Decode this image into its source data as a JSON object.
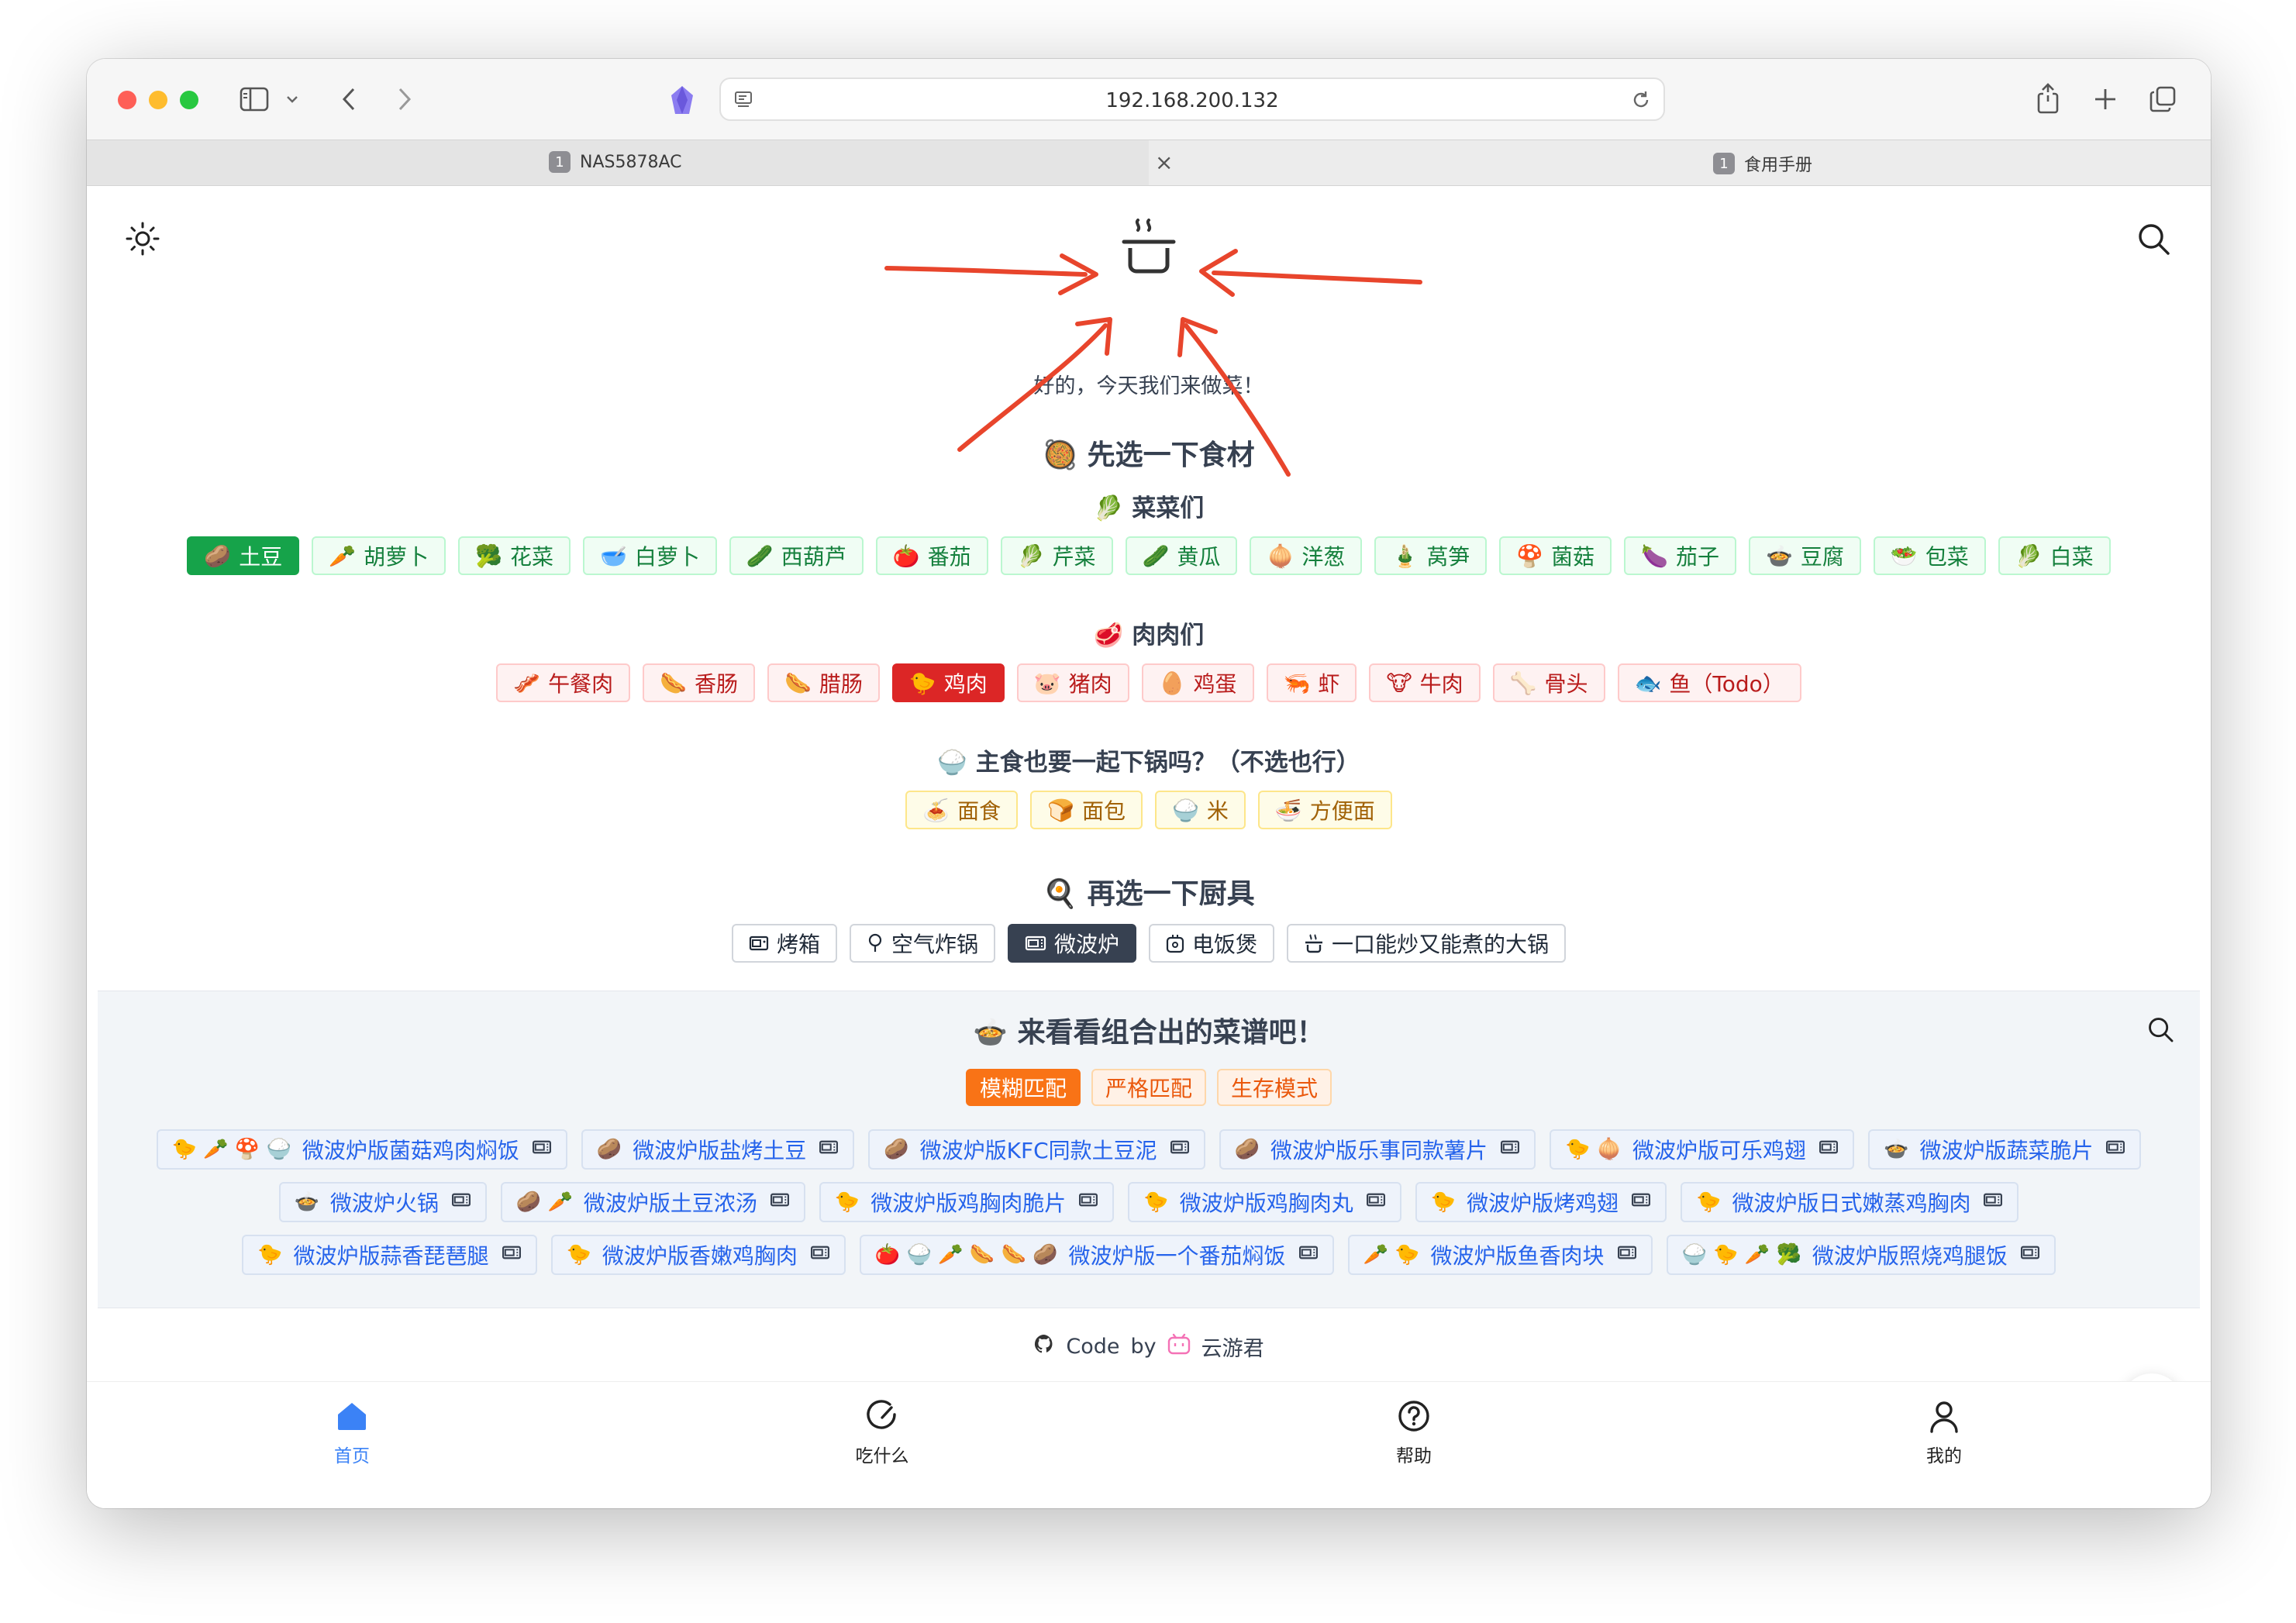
{
  "browser": {
    "url": "192.168.200.132",
    "tabs": [
      {
        "number": "1",
        "label": "NAS5878AC"
      },
      {
        "number": "1",
        "label": "食用手册"
      }
    ]
  },
  "header": {
    "subtitle": "好的，今天我们来做菜！"
  },
  "step1": {
    "title": "先选一下食材",
    "title_emoji": "🥘"
  },
  "vegetables": {
    "title": "菜菜们",
    "title_emoji": "🥬",
    "items": [
      {
        "emoji": "🥔",
        "label": "土豆",
        "selected": true
      },
      {
        "emoji": "🥕",
        "label": "胡萝卜",
        "selected": false
      },
      {
        "emoji": "🥦",
        "label": "花菜",
        "selected": false
      },
      {
        "emoji": "🥣",
        "label": "白萝卜",
        "selected": false
      },
      {
        "emoji": "🥒",
        "label": "西葫芦",
        "selected": false
      },
      {
        "emoji": "🍅",
        "label": "番茄",
        "selected": false
      },
      {
        "emoji": "🥬",
        "label": "芹菜",
        "selected": false
      },
      {
        "emoji": "🥒",
        "label": "黄瓜",
        "selected": false
      },
      {
        "emoji": "🧅",
        "label": "洋葱",
        "selected": false
      },
      {
        "emoji": "🎍",
        "label": "莴笋",
        "selected": false
      },
      {
        "emoji": "🍄",
        "label": "菌菇",
        "selected": false
      },
      {
        "emoji": "🍆",
        "label": "茄子",
        "selected": false
      },
      {
        "emoji": "🍲",
        "label": "豆腐",
        "selected": false
      },
      {
        "emoji": "🥗",
        "label": "包菜",
        "selected": false
      },
      {
        "emoji": "🥬",
        "label": "白菜",
        "selected": false
      }
    ]
  },
  "meats": {
    "title": "肉肉们",
    "title_emoji": "🥩",
    "items": [
      {
        "emoji": "🥓",
        "label": "午餐肉",
        "selected": false
      },
      {
        "emoji": "🌭",
        "label": "香肠",
        "selected": false
      },
      {
        "emoji": "🌭",
        "label": "腊肠",
        "selected": false
      },
      {
        "emoji": "🐤",
        "label": "鸡肉",
        "selected": true
      },
      {
        "emoji": "🐷",
        "label": "猪肉",
        "selected": false
      },
      {
        "emoji": "🥚",
        "label": "鸡蛋",
        "selected": false
      },
      {
        "emoji": "🦐",
        "label": "虾",
        "selected": false
      },
      {
        "emoji": "🐮",
        "label": "牛肉",
        "selected": false
      },
      {
        "emoji": "🦴",
        "label": "骨头",
        "selected": false
      },
      {
        "emoji": "🐟",
        "label": "鱼（Todo）",
        "selected": false
      }
    ]
  },
  "staples": {
    "title": "主食也要一起下锅吗？（不选也行）",
    "title_emoji": "🍚",
    "items": [
      {
        "emoji": "🍝",
        "label": "面食"
      },
      {
        "emoji": "🍞",
        "label": "面包"
      },
      {
        "emoji": "🍚",
        "label": "米"
      },
      {
        "emoji": "🍜",
        "label": "方便面"
      }
    ]
  },
  "step2": {
    "title": "再选一下厨具",
    "title_emoji": "🍳"
  },
  "tools": [
    {
      "icon": "oven-icon",
      "label": "烤箱",
      "selected": false
    },
    {
      "icon": "air-fryer-icon",
      "label": "空气炸锅",
      "selected": false
    },
    {
      "icon": "microwave-icon",
      "label": "微波炉",
      "selected": true
    },
    {
      "icon": "rice-cooker-icon",
      "label": "电饭煲",
      "selected": false
    },
    {
      "icon": "pot-icon",
      "label": "一口能炒又能煮的大锅",
      "selected": false
    }
  ],
  "recipes": {
    "title": "来看看组合出的菜谱吧！",
    "title_emoji": "🍲",
    "modes": [
      {
        "label": "模糊匹配",
        "selected": true
      },
      {
        "label": "严格匹配",
        "selected": false
      },
      {
        "label": "生存模式",
        "selected": false
      }
    ],
    "rows": [
      [
        {
          "emojis": "🐤 🥕 🍄 🍚",
          "name": "微波炉版菌菇鸡肉焖饭"
        },
        {
          "emojis": "🥔",
          "name": "微波炉版盐烤土豆"
        },
        {
          "emojis": "🥔",
          "name": "微波炉版KFC同款土豆泥"
        },
        {
          "emojis": "🥔",
          "name": "微波炉版乐事同款薯片"
        },
        {
          "emojis": "🐤 🧅",
          "name": "微波炉版可乐鸡翅"
        },
        {
          "emojis": "🍲",
          "name": "微波炉版蔬菜脆片"
        }
      ],
      [
        {
          "emojis": "🍲",
          "name": "微波炉火锅"
        },
        {
          "emojis": "🥔 🥕",
          "name": "微波炉版土豆浓汤"
        },
        {
          "emojis": "🐤",
          "name": "微波炉版鸡胸肉脆片"
        },
        {
          "emojis": "🐤",
          "name": "微波炉版鸡胸肉丸"
        },
        {
          "emojis": "🐤",
          "name": "微波炉版烤鸡翅"
        },
        {
          "emojis": "🐤",
          "name": "微波炉版日式嫩蒸鸡胸肉"
        }
      ],
      [
        {
          "emojis": "🐤",
          "name": "微波炉版蒜香琵琶腿"
        },
        {
          "emojis": "🐤",
          "name": "微波炉版香嫩鸡胸肉"
        },
        {
          "emojis": "🍅 🍚 🥕 🌭 🌭 🥔",
          "name": "微波炉版一个番茄焖饭"
        },
        {
          "emojis": "🥕 🐤",
          "name": "微波炉版鱼香肉块"
        },
        {
          "emojis": "🍚 🐤 🥕 🥦",
          "name": "微波炉版照烧鸡腿饭"
        }
      ]
    ]
  },
  "footer": {
    "code": "Code",
    "by": "by",
    "author": "云游君"
  },
  "bottom_nav": [
    {
      "icon": "home-icon",
      "label": "首页",
      "active": true
    },
    {
      "icon": "what-to-eat-icon",
      "label": "吃什么",
      "active": false
    },
    {
      "icon": "help-icon",
      "label": "帮助",
      "active": false
    },
    {
      "icon": "profile-icon",
      "label": "我的",
      "active": false
    }
  ],
  "colors": {
    "veg_selected": "#16a34a",
    "meat_selected": "#dc2626",
    "tool_selected": "#374151",
    "mode_selected": "#f97316",
    "recipe_link": "#2563eb",
    "nav_active": "#3b82f6",
    "annotation_arrows": "#e8452c"
  }
}
